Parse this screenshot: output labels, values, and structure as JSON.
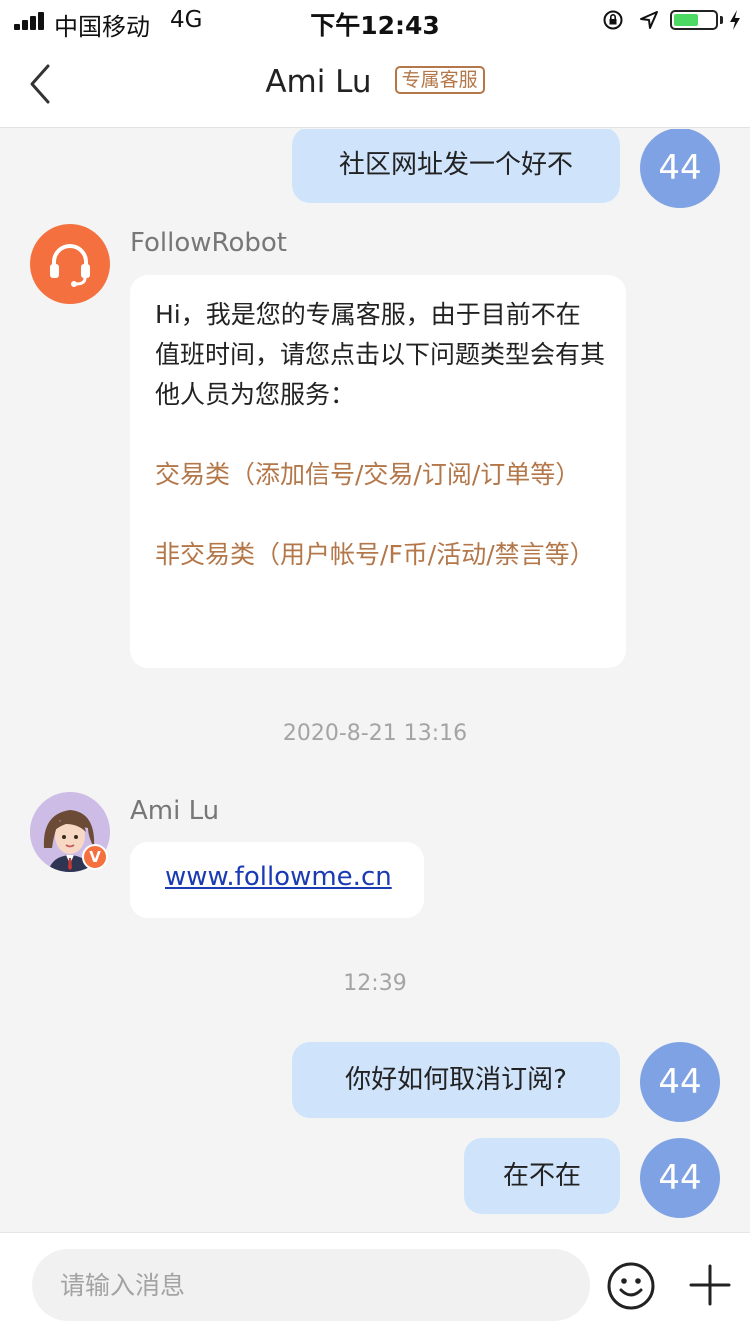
{
  "status_bar": {
    "carrier": "中国移动",
    "network": "4G",
    "time": "下午12:43",
    "battery_level": 0.6,
    "colors": {
      "battery": "#4cd964"
    }
  },
  "nav": {
    "back_icon": "chevron-left-icon",
    "title": "Ami Lu",
    "badge": "专属客服"
  },
  "messages": [
    {
      "type": "outgoing",
      "avatar": "44",
      "text": "社区网址发一个好不"
    },
    {
      "type": "incoming",
      "sender": "FollowRobot",
      "avatar_icon": "headset-icon",
      "lines": [
        "Hi，我是您的专属客服，由于目前不在值班时间，请您点击以下问题类型会有其他人员为您服务："
      ],
      "options": [
        "交易类（添加信号/交易/订阅/订单等）",
        "非交易类（用户帐号/F币/活动/禁言等）"
      ]
    },
    {
      "type": "timestamp",
      "text": "2020-8-21 13:16"
    },
    {
      "type": "incoming",
      "sender": "Ami Lu",
      "avatar_icon": "user-avatar-icon",
      "verified_badge": "V",
      "link": "www.followme.cn"
    },
    {
      "type": "timestamp",
      "text": "12:39"
    },
    {
      "type": "outgoing",
      "avatar": "44",
      "text": "你好如何取消订阅?"
    },
    {
      "type": "outgoing",
      "avatar": "44",
      "text": "在不在"
    }
  ],
  "input_bar": {
    "placeholder": "请输入消息",
    "emoji_icon": "emoji-icon",
    "plus_icon": "plus-icon"
  },
  "colors": {
    "outgoing_bubble": "#cfe3fb",
    "avatar_blue": "#7ea2e3",
    "accent_orange": "#b3774a",
    "robot_avatar": "#f4703f"
  }
}
